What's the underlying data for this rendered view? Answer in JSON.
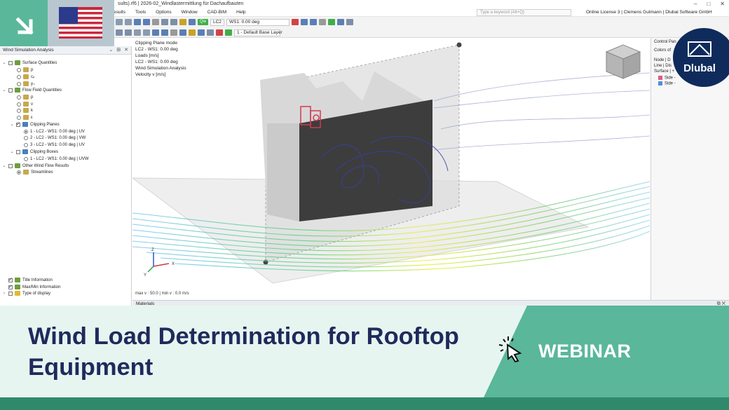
{
  "window": {
    "title": "sults).rf6 | 2026-02_Windlastermittlung für Dachaufbauten",
    "controls": [
      "–",
      "□",
      "✕"
    ]
  },
  "menubar": {
    "items": [
      "esults",
      "Tools",
      "Options",
      "Window",
      "CAD-BIM",
      "Help"
    ],
    "search_placeholder": "Type a keyword (Alt+Q)",
    "license": "Online License 3 | Clemens Gutmann | Dlubal Software GmbH"
  },
  "toolbar": {
    "load_case_badge": "Qw",
    "load_case": "LC2",
    "load_case_desc": "WS1: 0.00 deg",
    "layer": "1 - Default Base Layer"
  },
  "navigator": {
    "title": "Wind Simulation Analysis",
    "tree": [
      {
        "label": "Surface Quantities",
        "level": 0,
        "kind": "group"
      },
      {
        "label": "p",
        "level": 1,
        "kind": "radio"
      },
      {
        "label": "cₚ",
        "level": 1,
        "kind": "radio"
      },
      {
        "label": "y₊",
        "level": 1,
        "kind": "radio"
      },
      {
        "label": "Flow Field Quantities",
        "level": 0,
        "kind": "group"
      },
      {
        "label": "p",
        "level": 1,
        "kind": "radio"
      },
      {
        "label": "v",
        "level": 1,
        "kind": "radio"
      },
      {
        "label": "k",
        "level": 1,
        "kind": "radio"
      },
      {
        "label": "ε",
        "level": 1,
        "kind": "radio"
      },
      {
        "label": "Clipping Planes",
        "level": 1,
        "kind": "checked-group"
      },
      {
        "label": "1 - LC2 - WS1: 0.00 deg | UV",
        "level": 2,
        "kind": "radio-on"
      },
      {
        "label": "2 - LC2 - WS1: 0.00 deg | VW",
        "level": 2,
        "kind": "radio"
      },
      {
        "label": "3 - LC2 - WS1: 0.00 deg | UV",
        "level": 2,
        "kind": "radio"
      },
      {
        "label": "Clipping Boxes",
        "level": 1,
        "kind": "group"
      },
      {
        "label": "1 - LC2 - WS1: 0.00 deg | UVW",
        "level": 2,
        "kind": "radio"
      },
      {
        "label": "Other Wind Flow Results",
        "level": 0,
        "kind": "group"
      },
      {
        "label": "Streamlines",
        "level": 1,
        "kind": "radio-on"
      }
    ],
    "display_options": [
      "Title Information",
      "Max/Min Information",
      "Type of display"
    ]
  },
  "viewport": {
    "info_lines": [
      "Clipping Plane mode",
      "LC2 - WS1: 0.00 deg",
      "Loads [m/s]",
      "LC2 - WS1: 0.00 deg",
      "Wind Simulation Analysis",
      "Velocity v [m/s]"
    ],
    "footer": "max v : 50.0 | min v : 0.0 m/s",
    "axes": {
      "x": "X",
      "y": "Y",
      "z": "Z"
    }
  },
  "control_panel": {
    "title": "Control Pan",
    "lines": [
      "Colors of",
      "Node | D",
      "Line | Dis",
      "Surface | +"
    ],
    "items": [
      {
        "label": "Side -",
        "color": "#e05a8c"
      },
      {
        "label": "Side -",
        "color": "#4a90d9"
      }
    ]
  },
  "materials_bar": {
    "label": "Materials"
  },
  "logo": {
    "text": "Dlubal"
  },
  "banner": {
    "title": "Wind Load Determination for Rooftop Equipment",
    "tag": "WEBINAR"
  },
  "colors": {
    "accent_green": "#5ab79a",
    "banner_bg": "#e7f5f1",
    "title_navy": "#1f2a5c",
    "logo_navy": "#0f2b5c"
  }
}
